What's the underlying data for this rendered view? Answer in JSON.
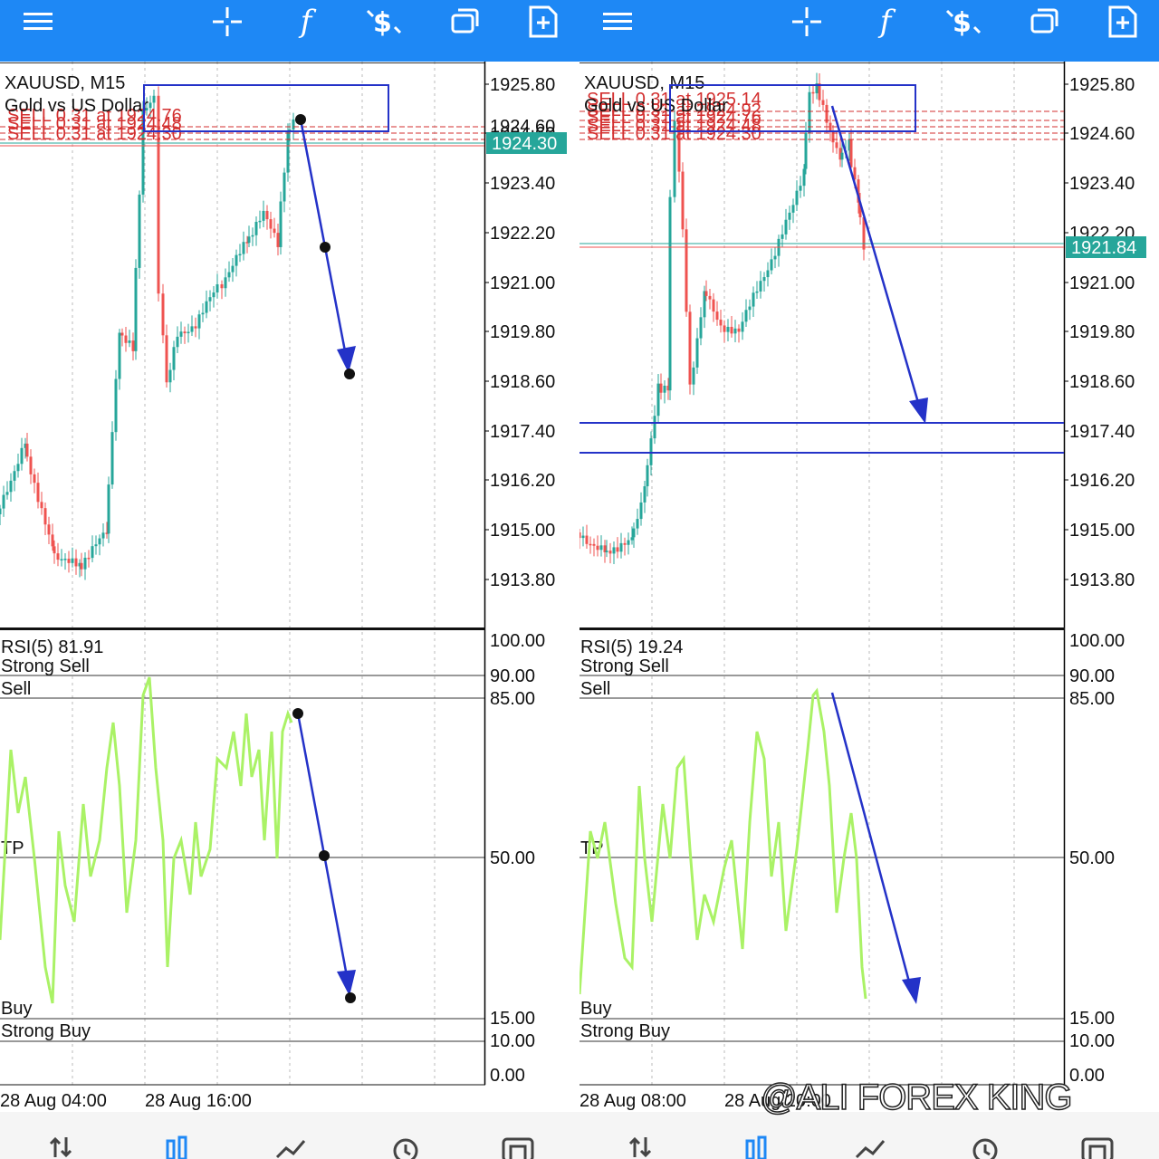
{
  "colors": {
    "toolbar": "#1e88f5",
    "bull": "#26a69a",
    "bear": "#ef5350",
    "rsi": "#aaf266",
    "annotation": "#2432c8",
    "order_line": "#d32f2f",
    "price_tag": "#26a69a"
  },
  "toolbar_icons": [
    "menu-icon",
    "crosshair-icon",
    "indicators-icon",
    "trade-icon",
    "windows-icon",
    "new-order-icon"
  ],
  "toolbar_glyphs": {
    "menu-icon": "",
    "crosshair-icon": "",
    "indicators-icon": "f",
    "trade-icon": "$",
    "windows-icon": "",
    "new-order-icon": ""
  },
  "bottom_nav": [
    "quotes-icon",
    "chart-icon",
    "trade-icon",
    "history-icon",
    "messages-icon"
  ],
  "watermark": "@ALI FOREX KING",
  "left": {
    "symbol": "XAUUSD, M15",
    "description": "Gold vs US Dollar",
    "current_price": "1924.30",
    "price_axis": [
      "1925.80",
      "1924.60",
      "1923.40",
      "1922.20",
      "1921.00",
      "1919.80",
      "1918.60",
      "1917.40",
      "1916.20",
      "1915.00",
      "1913.80"
    ],
    "orders": [
      "SELL 0.31 at 1924.76",
      "SELL 0.31 at 1924.48",
      "SELL 0.31 at 1924.30"
    ],
    "rsi_label": "RSI(5) 81.91",
    "rsi_levels": [
      "Strong Sell",
      "Sell",
      "TP",
      "Buy",
      "Strong Buy"
    ],
    "rsi_axis": [
      "100.00",
      "90.00",
      "85.00",
      "50.00",
      "15.00",
      "10.00",
      "0.00"
    ],
    "time_axis": [
      "28 Aug 04:00",
      "28 Aug 16:00"
    ]
  },
  "right": {
    "symbol": "XAUUSD, M15",
    "description": "Gold vs US Dollar",
    "current_price": "1921.84",
    "price_axis": [
      "1925.80",
      "1924.60",
      "1923.40",
      "1922.20",
      "1921.00",
      "1919.80",
      "1918.60",
      "1917.40",
      "1916.20",
      "1915.00",
      "1913.80"
    ],
    "orders": [
      "SELL 0.31 at 1925.14",
      "SELL 0.31 at 1924.92",
      "SELL 0.31 at 1924.76",
      "SELL 0.31 at 1924.48",
      "SELL 0.31 at 1924.30"
    ],
    "rsi_label": "RSI(5) 19.24",
    "rsi_levels": [
      "Strong Sell",
      "Sell",
      "TP",
      "Buy",
      "Strong Buy"
    ],
    "rsi_axis": [
      "100.00",
      "90.00",
      "85.00",
      "50.00",
      "15.00",
      "10.00",
      "0.00"
    ],
    "time_axis": [
      "28 Aug 08:00",
      "28 Aug 20:00"
    ]
  }
}
